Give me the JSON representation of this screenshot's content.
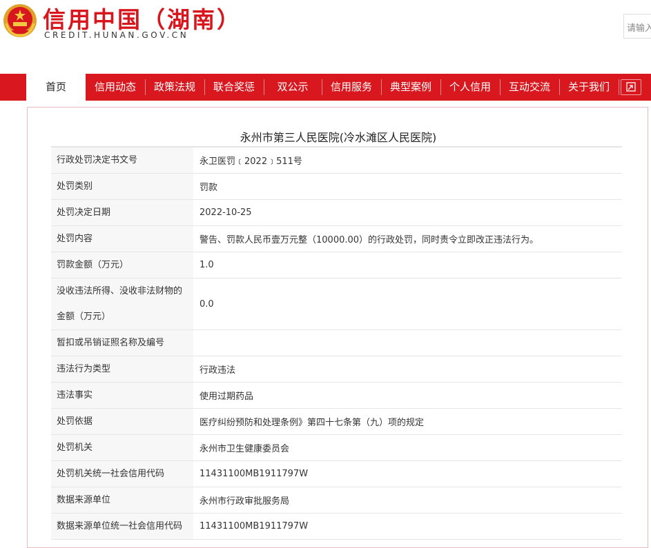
{
  "header": {
    "title": "信用中国（湖南）",
    "url": "CREDIT.HUNAN.GOV.CN",
    "search_placeholder": "请输入"
  },
  "nav": {
    "items": [
      "首页",
      "信用动态",
      "政策法规",
      "联合奖惩",
      "双公示",
      "信用服务",
      "典型案例",
      "个人信用",
      "互动交流",
      "关于我们"
    ],
    "active": "首页"
  },
  "record": {
    "title": "永州市第三人民医院(冷水滩区人民医院)",
    "rows": [
      {
        "label": "行政处罚决定书文号",
        "value": "永卫医罚﹝2022﹞511号"
      },
      {
        "label": "处罚类别",
        "value": "罚款"
      },
      {
        "label": "处罚决定日期",
        "value": "2022-10-25"
      },
      {
        "label": "处罚内容",
        "value": "警告、罚款人民币壹万元整（10000.00）的行政处罚，同时责令立即改正违法行为。"
      },
      {
        "label": "罚款金额（万元）",
        "value": "1.0"
      },
      {
        "label": "没收违法所得、没收非法财物的金额（万元）",
        "value": "0.0"
      },
      {
        "label": "暂扣或吊销证照名称及编号",
        "value": ""
      },
      {
        "label": "违法行为类型",
        "value": "行政违法"
      },
      {
        "label": "违法事实",
        "value": "使用过期药品"
      },
      {
        "label": "处罚依据",
        "value": "医疗纠纷预防和处理条例》第四十七条第（九）项的规定"
      },
      {
        "label": "处罚机关",
        "value": "永州市卫生健康委员会"
      },
      {
        "label": "处罚机关统一社会信用代码",
        "value": "11431100MB1911797W"
      },
      {
        "label": "数据来源单位",
        "value": "永州市行政审批服务局"
      },
      {
        "label": "数据来源单位统一社会信用代码",
        "value": "11431100MB1911797W"
      }
    ]
  },
  "colors": {
    "brand_red": "#d8171e",
    "label_bg": "#f7f7f7"
  },
  "icons": {
    "emblem": "national-emblem-icon",
    "nav_extra": "expand-icon"
  }
}
